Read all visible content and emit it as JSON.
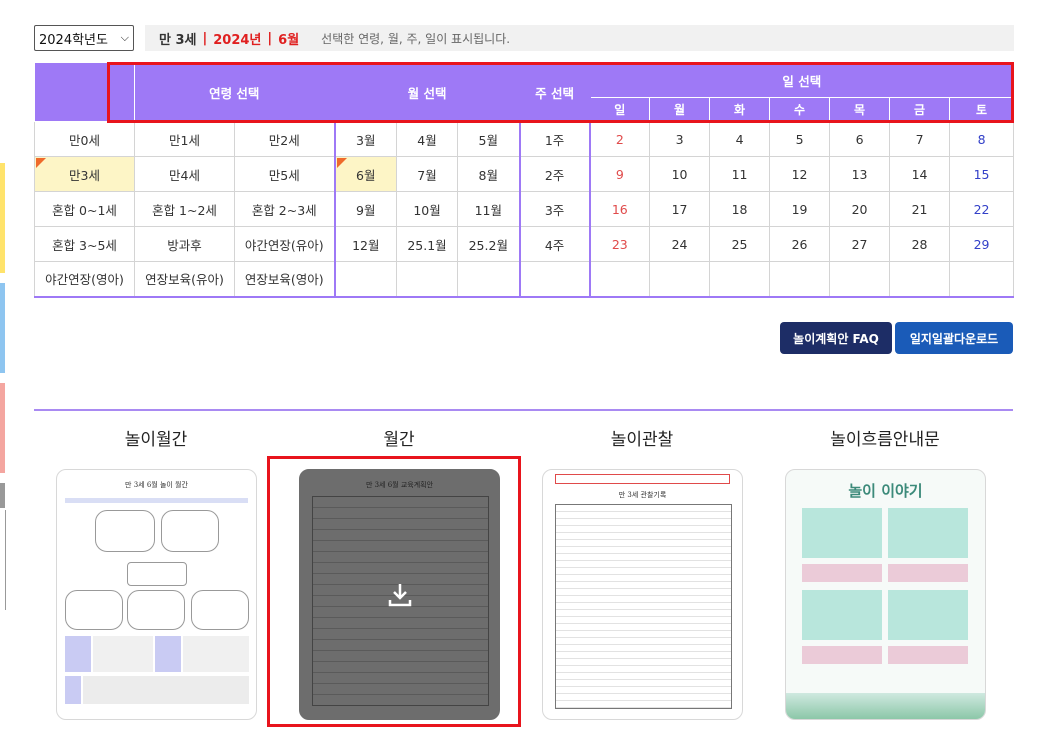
{
  "year_select": {
    "value": "2024학년도"
  },
  "info": {
    "age": "만 3세",
    "year": "2024년",
    "month": "6월",
    "description": "선택한 연령, 월, 주, 일이 표시됩니다."
  },
  "headers": {
    "age": "연령 선택",
    "month": "월 선택",
    "week": "주 선택",
    "day": "일 선택",
    "weekdays": [
      "일",
      "월",
      "화",
      "수",
      "목",
      "금",
      "토"
    ]
  },
  "rows": [
    {
      "ages": [
        "만0세",
        "만1세",
        "만2세"
      ],
      "months": [
        "3월",
        "4월",
        "5월"
      ],
      "week": "1주",
      "days": [
        "2",
        "3",
        "4",
        "5",
        "6",
        "7",
        "8"
      ]
    },
    {
      "ages": [
        "만3세",
        "만4세",
        "만5세"
      ],
      "months": [
        "6월",
        "7월",
        "8월"
      ],
      "week": "2주",
      "days": [
        "9",
        "10",
        "11",
        "12",
        "13",
        "14",
        "15"
      ]
    },
    {
      "ages": [
        "혼합 0~1세",
        "혼합 1~2세",
        "혼합 2~3세"
      ],
      "months": [
        "9월",
        "10월",
        "11월"
      ],
      "week": "3주",
      "days": [
        "16",
        "17",
        "18",
        "19",
        "20",
        "21",
        "22"
      ]
    },
    {
      "ages": [
        "혼합 3~5세",
        "방과후",
        "야간연장(유아)"
      ],
      "months": [
        "12월",
        "25.1월",
        "25.2월"
      ],
      "week": "4주",
      "days": [
        "23",
        "24",
        "25",
        "26",
        "27",
        "28",
        "29"
      ]
    },
    {
      "ages": [
        "야간연장(영아)",
        "연장보육(유아)",
        "연장보육(영아)"
      ],
      "months": [
        "",
        "",
        ""
      ],
      "week": "",
      "days": [
        "",
        "",
        "",
        "",
        "",
        "",
        ""
      ]
    }
  ],
  "buttons": {
    "faq": "놀이계획안 FAQ",
    "download": "일지일괄다운로드"
  },
  "cards": [
    {
      "title": "놀이월간",
      "thumb_heading": "만 3세 6월 놀이 월간"
    },
    {
      "title": "월간",
      "thumb_heading": "만 3세 6월 교육계획안"
    },
    {
      "title": "놀이관찰",
      "thumb_heading": "만 3세 관찰기록"
    },
    {
      "title": "놀이흐름안내문",
      "thumb_heading": "놀이 이야기"
    }
  ],
  "colors": {
    "header_purple": "#9e79f6",
    "highlight_red": "#e8141c",
    "selected_yellow": "#fdf5c6",
    "navy_button": "#1d2d66",
    "blue_button": "#1a5bb8"
  }
}
